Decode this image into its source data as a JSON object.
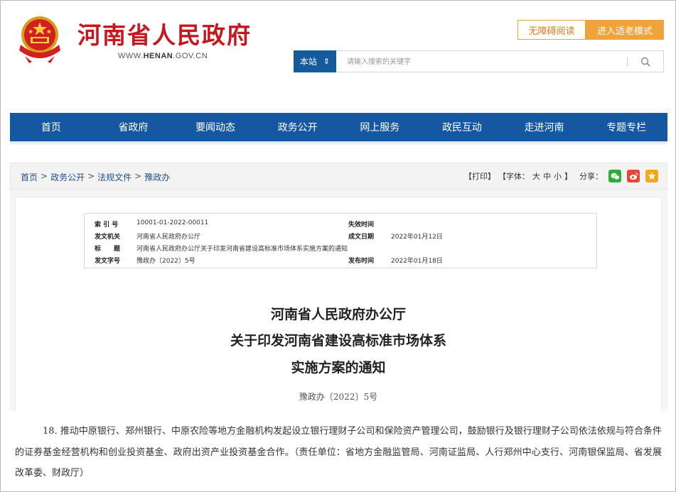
{
  "header": {
    "site_title": "河南省人民政府",
    "site_url_prefix": "WWW.",
    "site_url_brand": "HENAN",
    "site_url_suffix": ".GOV.CN",
    "accessibility_label": "无障碍阅读",
    "elder_mode_label": "进入适老模式"
  },
  "search": {
    "scope_label": "本站",
    "scope_arrow": "⇕",
    "placeholder": "请输入搜索的关键字"
  },
  "nav": {
    "items": [
      "首页",
      "省政府",
      "要闻动态",
      "政务公开",
      "网上服务",
      "政民互动",
      "走进河南",
      "专题专栏"
    ]
  },
  "breadcrumb": {
    "items": [
      "首页",
      "政务公开",
      "法规文件",
      "豫政办"
    ],
    "separator": ">"
  },
  "tools": {
    "print": "【打印】",
    "font_prefix": "【字体：",
    "font_large": "大",
    "font_medium": "中",
    "font_small": "小",
    "font_suffix": "】",
    "share_label": "分享："
  },
  "meta": {
    "index_key": "索 引 号",
    "index_val": "10001-01-2022-00011",
    "expire_key": "失效时间",
    "expire_val": "",
    "issuer_key": "发文机关",
    "issuer_val": "河南省人民政府办公厅",
    "created_key": "成文日期",
    "created_val": "2022年01月12日",
    "title_key": "标　　题",
    "title_val": "河南省人民政府办公厅关于印发河南省建设高标准市场体系实施方案的通知",
    "docno_key": "发文字号",
    "docno_val": "豫政办〔2022〕5号",
    "published_key": "发布时间",
    "published_val": "2022年01月18日"
  },
  "document": {
    "title_line1": "河南省人民政府办公厅",
    "title_line2": "关于印发河南省建设高标准市场体系",
    "title_line3": "实施方案的通知",
    "doc_number": "豫政办〔2022〕5号",
    "body": "18. 推动中原银行、郑州银行、中原农险等地方金融机构发起设立银行理财子公司和保险资产管理公司，鼓励银行及银行理财子公司依法依规与符合条件的证券基金经营机构和创业投资基金、政府出资产业投资基金合作。（责任单位：省地方金融监管局、河南证监局、人行郑州中心支行、河南银保监局、省发展改革委、财政厅）"
  },
  "colors": {
    "brand_red": "#c8161d",
    "nav_blue": "#1558a1",
    "accent_orange": "#f0a33a",
    "link_blue": "#1f4e8c"
  },
  "icons": {
    "emblem": "national-emblem-icon",
    "search": "search-icon",
    "wechat": "wechat-icon",
    "weibo": "weibo-icon",
    "favorite": "star-icon"
  }
}
